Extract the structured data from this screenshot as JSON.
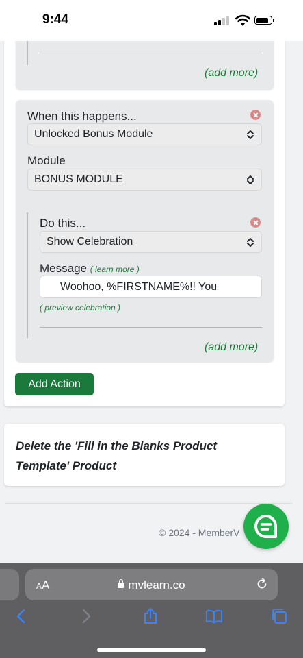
{
  "status_bar": {
    "time": "9:44"
  },
  "panel1": {
    "add_more": "(add more)"
  },
  "panel2": {
    "trigger_label": "When this happens...",
    "trigger_value": "Unlocked Bonus Module",
    "module_label": "Module",
    "module_value": "BONUS MODULE",
    "action": {
      "label": "Do this...",
      "value": "Show Celebration",
      "message_label": "Message",
      "learn_more": "( learn more )",
      "message_value": "Woohoo, %FIRSTNAME%!! You",
      "preview": "( preview celebration )"
    },
    "add_more": "(add more)"
  },
  "add_action_label": "Add Action",
  "card2_title": "Delete the 'Fill in the Blanks Product Template' Product",
  "footer": {
    "copyright": "© 2024 - MemberV"
  },
  "browser": {
    "aa_big": "A",
    "aa_small": "A",
    "url": "mvlearn.co"
  },
  "colors": {
    "accent_green": "#1a7a3c",
    "chat_green": "#20b04b",
    "link_blue": "#3b82f6"
  }
}
